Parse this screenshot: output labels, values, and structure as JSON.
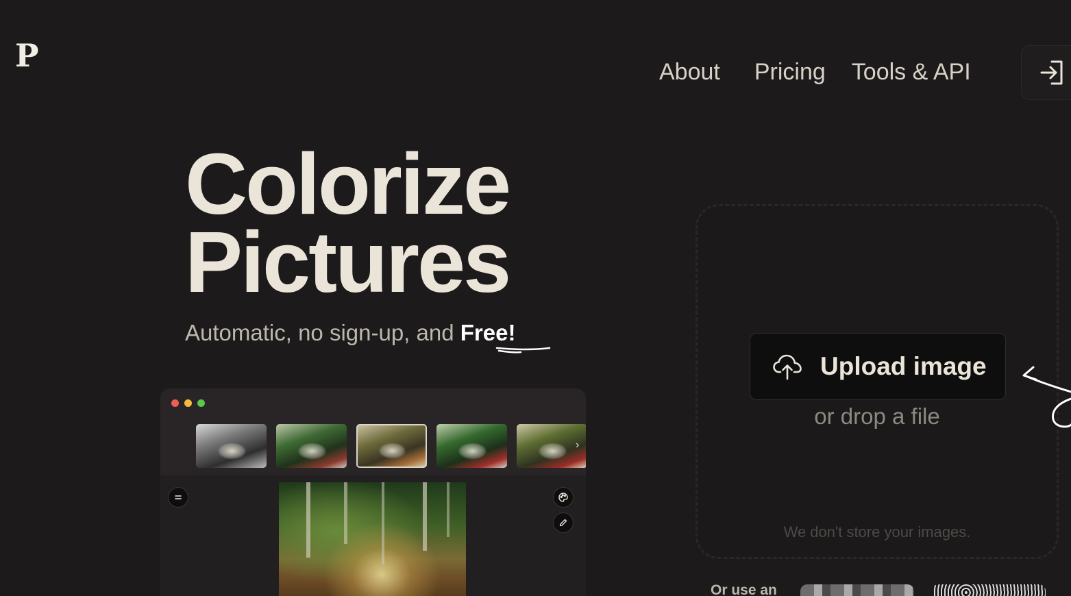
{
  "header": {
    "logo_text": "P",
    "nav": {
      "about": "About",
      "pricing": "Pricing",
      "tools": "Tools & API"
    },
    "login_icon": "login-icon"
  },
  "hero": {
    "title_line1": "Colorize",
    "title_line2": "Pictures",
    "subtitle_lead": "Automatic, no sign-up, and ",
    "subtitle_emphasis": "Free!"
  },
  "preview": {
    "window_dots": [
      "#ee5f57",
      "#f4b93e",
      "#5cc74b"
    ],
    "thumbnails": [
      "black-and-white original",
      "colorized variant 1",
      "colorized variant 2 (selected)",
      "colorized variant 3",
      "colorized variant 4"
    ],
    "selected_thumbnail": 2,
    "chevron": "›",
    "icons": [
      "menu-icon",
      "palette-icon",
      "pencil-icon"
    ]
  },
  "upload": {
    "button_label": "Upload image",
    "button_icon": "cloud-upload-icon",
    "drop_text": "or drop a file",
    "privacy_note": "We don't store your images."
  },
  "examples": {
    "lead_text": "Or use an"
  },
  "colors": {
    "background": "#1c1a1b",
    "title": "#ebe5d9",
    "muted": "#8e8981"
  }
}
